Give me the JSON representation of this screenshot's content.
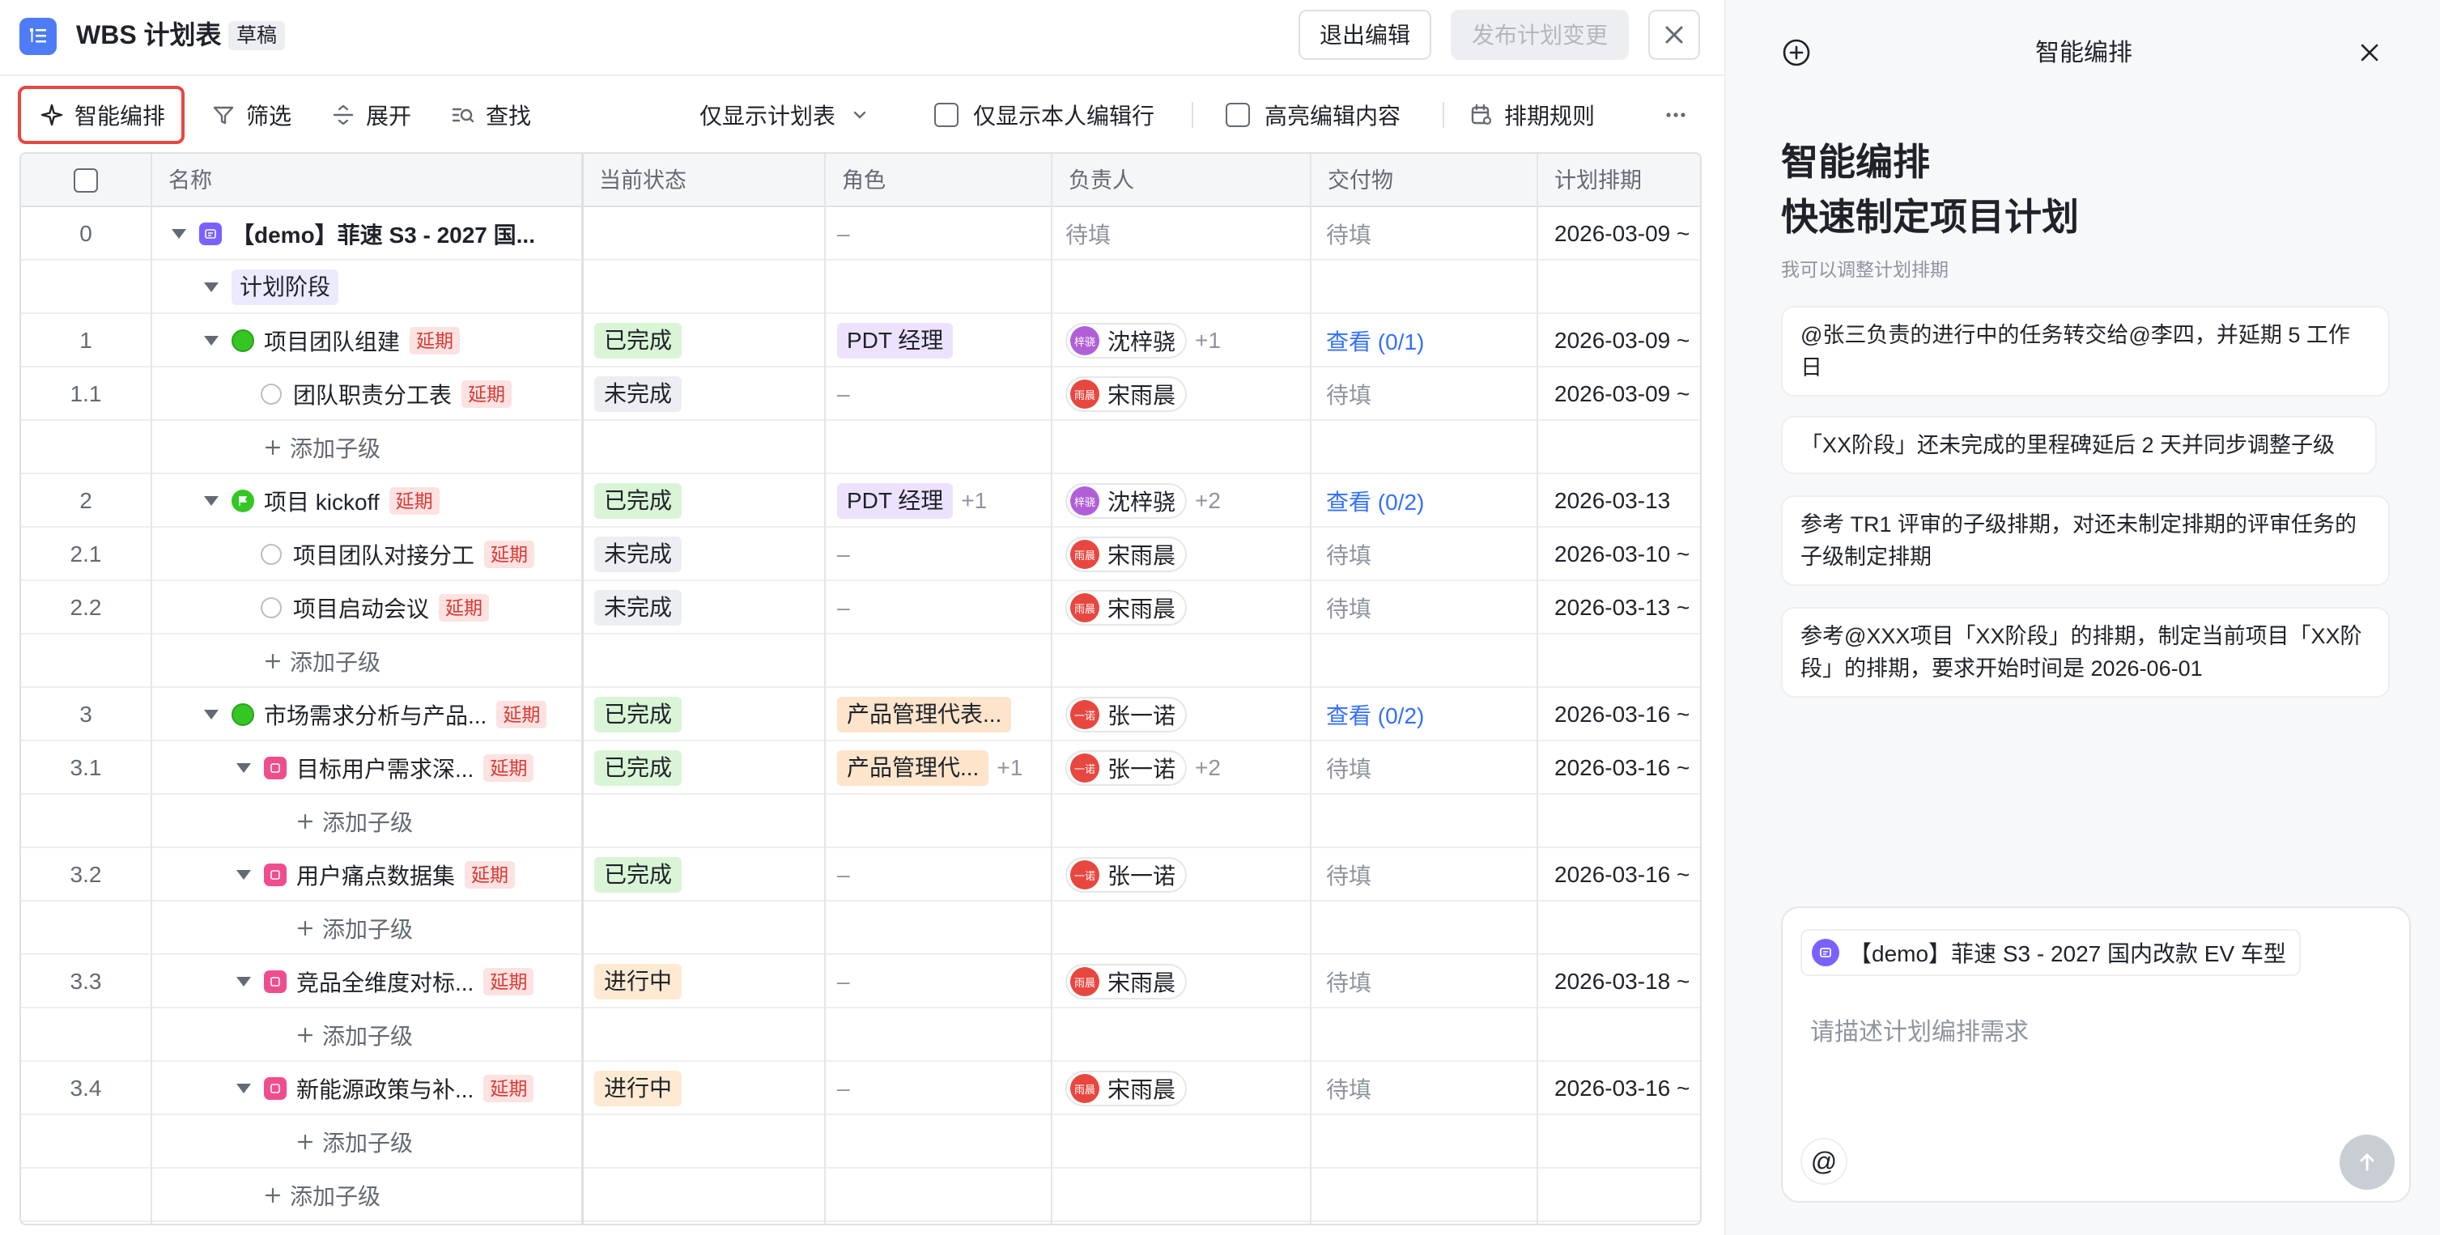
{
  "header": {
    "title": "WBS 计划表",
    "draft_badge": "草稿",
    "exit_button": "退出编辑",
    "publish_button": "发布计划变更"
  },
  "toolbar": {
    "smart": "智能编排",
    "filter": "筛选",
    "expand": "展开",
    "find": "查找",
    "view_select": "仅显示计划表",
    "only_mine": "仅显示本人编辑行",
    "highlight": "高亮编辑内容",
    "rules": "排期规则"
  },
  "columns": [
    "名称",
    "当前状态",
    "角色",
    "负责人",
    "交付物",
    "计划排期"
  ],
  "rows": [
    {
      "idx": "0",
      "name": "【demo】菲速 S3 - 2027 国...",
      "status": "",
      "role": "–",
      "owner": "待填",
      "deliverable": "待填",
      "date": "2026-03-09 ~"
    },
    {
      "idx": "",
      "name": "计划阶段"
    },
    {
      "idx": "1",
      "name": "项目团队组建",
      "delay": "延期",
      "status": "已完成",
      "role": "PDT 经理",
      "owner": "沈梓骁",
      "owner_av": "梓骁",
      "owner_more": "+1",
      "deliverable": "查看 (0/1)",
      "date": "2026-03-09 ~"
    },
    {
      "idx": "1.1",
      "name": "团队职责分工表",
      "delay": "延期",
      "status": "未完成",
      "role": "–",
      "owner": "宋雨晨",
      "owner_av": "雨晨",
      "deliverable": "待填",
      "date": "2026-03-09 ~"
    },
    {
      "add": "添加子级"
    },
    {
      "idx": "2",
      "name": "项目 kickoff",
      "delay": "延期",
      "status": "已完成",
      "role": "PDT 经理",
      "role_more": "+1",
      "owner": "沈梓骁",
      "owner_av": "梓骁",
      "owner_more": "+2",
      "deliverable": "查看 (0/2)",
      "date": "2026-03-13"
    },
    {
      "idx": "2.1",
      "name": "项目团队对接分工",
      "delay": "延期",
      "status": "未完成",
      "role": "–",
      "owner": "宋雨晨",
      "owner_av": "雨晨",
      "deliverable": "待填",
      "date": "2026-03-10 ~"
    },
    {
      "idx": "2.2",
      "name": "项目启动会议",
      "delay": "延期",
      "status": "未完成",
      "role": "–",
      "owner": "宋雨晨",
      "owner_av": "雨晨",
      "deliverable": "待填",
      "date": "2026-03-13 ~"
    },
    {
      "add": "添加子级"
    },
    {
      "idx": "3",
      "name": "市场需求分析与产品...",
      "delay": "延期",
      "status": "已完成",
      "role": "产品管理代表...",
      "owner": "张一诺",
      "owner_av": "一诺",
      "deliverable": "查看 (0/2)",
      "date": "2026-03-16 ~"
    },
    {
      "idx": "3.1",
      "name": "目标用户需求深...",
      "delay": "延期",
      "status": "已完成",
      "role": "产品管理代...",
      "role_more": "+1",
      "owner": "张一诺",
      "owner_av": "一诺",
      "owner_more": "+2",
      "deliverable": "待填",
      "date": "2026-03-16 ~"
    },
    {
      "add": "添加子级"
    },
    {
      "idx": "3.2",
      "name": "用户痛点数据集",
      "delay": "延期",
      "status": "已完成",
      "role": "–",
      "owner": "张一诺",
      "owner_av": "一诺",
      "deliverable": "待填",
      "date": "2026-03-16 ~"
    },
    {
      "add": "添加子级"
    },
    {
      "idx": "3.3",
      "name": "竞品全维度对标...",
      "delay": "延期",
      "status": "进行中",
      "role": "–",
      "owner": "宋雨晨",
      "owner_av": "雨晨",
      "deliverable": "待填",
      "date": "2026-03-18 ~"
    },
    {
      "add": "添加子级"
    },
    {
      "idx": "3.4",
      "name": "新能源政策与补...",
      "delay": "延期",
      "status": "进行中",
      "role": "–",
      "owner": "宋雨晨",
      "owner_av": "雨晨",
      "deliverable": "待填",
      "date": "2026-03-16 ~"
    },
    {
      "add": "添加子级"
    },
    {
      "add": "添加子级"
    }
  ],
  "panel": {
    "title": "智能编排",
    "heading_line1": "智能编排",
    "heading_line2": "快速制定项目计划",
    "subtitle": "我可以调整计划排期",
    "suggestions": [
      "@张三负责的进行中的任务转交给@李四，并延期 5 工作日",
      "「XX阶段」还未完成的里程碑延后 2 天并同步调整子级",
      "参考 TR1 评审的子级排期，对还未制定排期的评审任务的子级制定排期",
      "参考@XXX项目「XX阶段」的排期，制定当前项目「XX阶段」的排期，要求开始时间是 2026-06-01"
    ],
    "context_chip": "【demo】菲速 S3 - 2027 国内改款 EV 车型",
    "input_placeholder": "请描述计划编排需求",
    "at_symbol": "@"
  },
  "colors": {
    "accent": "#3370ff",
    "delay_bg": "#fde2e2",
    "done": "#d9f5d6",
    "doing": "#feead2",
    "highlight_border": "#e8473f"
  }
}
